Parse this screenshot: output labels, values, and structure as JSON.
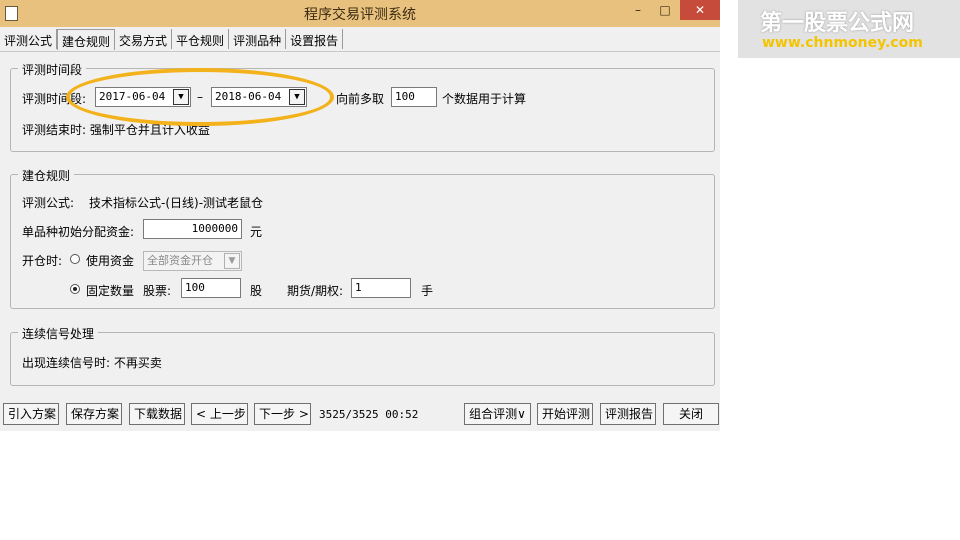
{
  "window": {
    "title": "程序交易评测系统",
    "minimize": "–",
    "maximize": "□",
    "close": "✕"
  },
  "tabs": [
    "评测公式",
    "建仓规则",
    "交易方式",
    "平仓规则",
    "评测品种",
    "设置报告"
  ],
  "period": {
    "legend": "评测时间段",
    "label": "评测时间段:",
    "start_date": "2017-06-04",
    "separator": "–",
    "end_date": "2018-06-04",
    "lookback_label": "向前多取",
    "lookback_value": "100",
    "lookback_suffix": "个数据用于计算",
    "end_text": "评测结束时: 强制平仓并且计入收益"
  },
  "build": {
    "legend": "建仓规则",
    "formula_label": "评测公式:",
    "formula_value": "技术指标公式-(日线)-测试老鼠仓",
    "capital_label": "单品种初始分配资金:",
    "capital_value": "1000000",
    "capital_unit": "元",
    "open_label": "开仓时:",
    "use_capital_label": "使用资金",
    "capital_mode": "全部资金开仓",
    "fixed_qty_label": "固定数量",
    "stock_label": "股票:",
    "stock_qty": "100",
    "stock_unit": "股",
    "futures_label": "期货/期权:",
    "futures_qty": "1",
    "futures_unit": "手"
  },
  "signal": {
    "legend": "连续信号处理",
    "text": "出现连续信号时: 不再买卖"
  },
  "toolbar": {
    "import": "引入方案",
    "save": "保存方案",
    "download": "下载数据",
    "prev": "< 上一步",
    "next": "下一步 >",
    "status": "3525/3525 00:52",
    "combo": "组合评测∨",
    "start": "开始评测",
    "report": "评测报告",
    "close": "关闭"
  },
  "watermark": {
    "title": "第一股票公式网",
    "url": "www.chnmoney.com"
  }
}
